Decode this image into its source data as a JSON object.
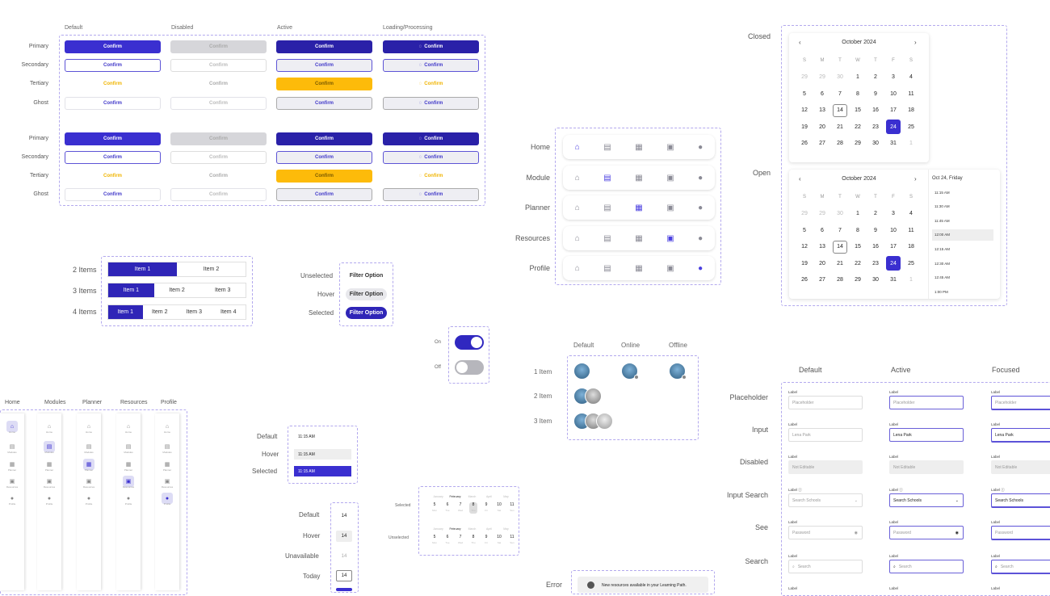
{
  "buttons": {
    "col_headers": [
      "Default",
      "Disabled",
      "Active",
      "Loading/Processing"
    ],
    "row_labels": [
      "Primary",
      "Secondary",
      "Tertiary",
      "Ghost"
    ],
    "label": "Confirm",
    "loading_icon": "spinner-icon"
  },
  "segmented": {
    "rows": [
      {
        "label": "2 Items",
        "items": [
          "Item 1",
          "Item 2"
        ]
      },
      {
        "label": "3 Items",
        "items": [
          "Item 1",
          "Item 2",
          "Item 3"
        ]
      },
      {
        "label": "4 Items",
        "items": [
          "Item 1",
          "Item 2",
          "Item 3",
          "Item 4"
        ]
      }
    ]
  },
  "filter": {
    "labels": [
      "Unselected",
      "Hover",
      "Selected"
    ],
    "chip": "Filter Option"
  },
  "toggle": {
    "on": "On",
    "off": "Off"
  },
  "bottom_nav": {
    "labels": [
      "Home",
      "Module",
      "Planner",
      "Resources",
      "Profile"
    ],
    "icons": [
      "home-icon",
      "module-icon",
      "planner-icon",
      "resources-icon",
      "profile-icon"
    ]
  },
  "sidebar_nav": {
    "labels": [
      "Home",
      "Modules",
      "Planner",
      "Resources",
      "Profile"
    ],
    "item_captions": [
      "Home",
      "Modules",
      "Planner",
      "Resources",
      "Profile"
    ]
  },
  "time_slot": {
    "labels": [
      "Default",
      "Hover",
      "Selected"
    ],
    "value": "11:15 AM"
  },
  "day_cell": {
    "labels": [
      "Default",
      "Hover",
      "Unavailable",
      "Today"
    ],
    "value": "14"
  },
  "month_picker": {
    "labels": [
      "Selected",
      "Unselected"
    ],
    "months": [
      "January",
      "February",
      "March",
      "April",
      "May"
    ],
    "days": [
      "5",
      "6",
      "7",
      "8",
      "9",
      "10",
      "11"
    ],
    "weekdays": [
      "Mon",
      "Tue",
      "Wed",
      "Thu",
      "Fri",
      "Sat",
      "Sun"
    ]
  },
  "avatars": {
    "col_headers": [
      "Default",
      "Online",
      "Offline"
    ],
    "row_labels": [
      "1 Item",
      "2 Item",
      "3 Item"
    ]
  },
  "calendar": {
    "labels": [
      "Closed",
      "Open"
    ],
    "month": "October 2024",
    "weekdays": [
      "S",
      "M",
      "T",
      "W",
      "T",
      "F",
      "S"
    ],
    "days": [
      "29",
      "29",
      "30",
      "1",
      "2",
      "3",
      "4",
      "5",
      "6",
      "7",
      "8",
      "9",
      "10",
      "11",
      "12",
      "13",
      "14",
      "15",
      "16",
      "17",
      "18",
      "19",
      "20",
      "21",
      "22",
      "23",
      "24",
      "25",
      "26",
      "27",
      "28",
      "29",
      "30",
      "31",
      "1"
    ],
    "selected_date": "Oct 24, Friday",
    "times": [
      "11:15 AM",
      "11:30 AM",
      "11:45 AM",
      "12:00 AM",
      "12:15 AM",
      "12:30 AM",
      "12:45 AM",
      "1:00 PM"
    ]
  },
  "inputs": {
    "col_headers": [
      "Default",
      "Active",
      "Focused"
    ],
    "row_labels": [
      "Placeholder",
      "Input",
      "Disabled",
      "Input Search",
      "See",
      "Search"
    ],
    "label": "Label",
    "search_label": "Label ⓘ",
    "placeholder": "Placeholder",
    "value": "Lena Park",
    "disabled": "Not Editable",
    "search_schools": "Search Schools",
    "password": "Password",
    "search": "Search"
  },
  "alert": {
    "label": "Error",
    "text": "New resources available in your Learning Path."
  }
}
